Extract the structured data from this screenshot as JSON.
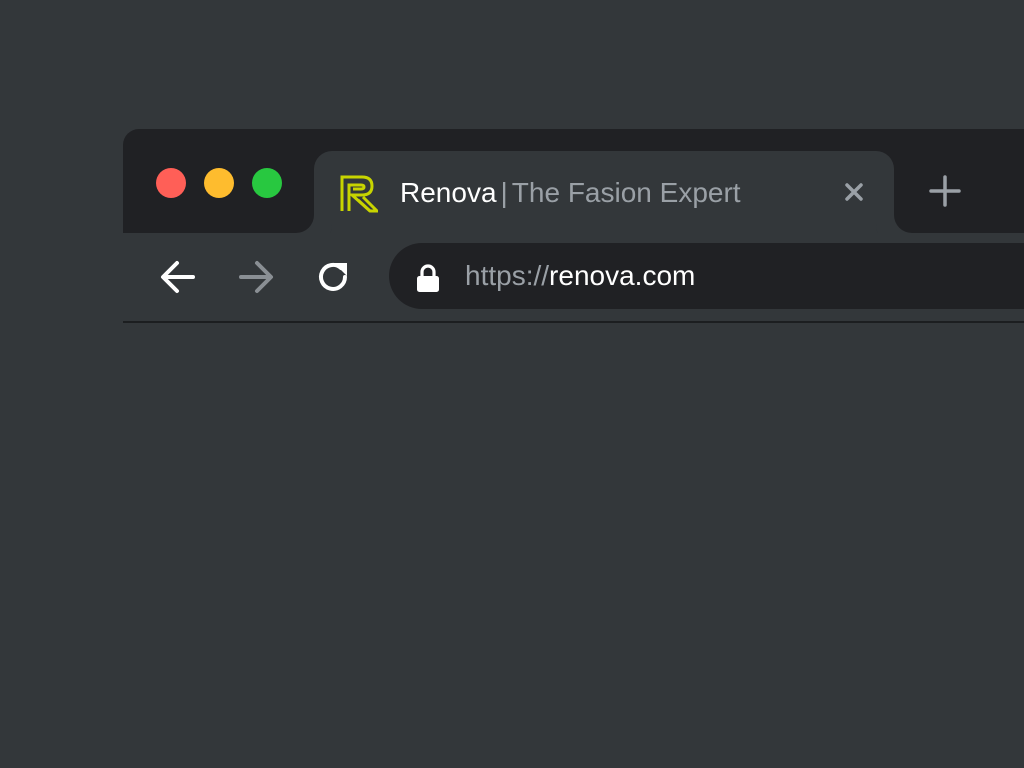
{
  "window": {
    "traffic_lights": {
      "close_color": "#ff5f57",
      "minimize_color": "#febc2e",
      "maximize_color": "#28c840"
    }
  },
  "tab": {
    "favicon": "renova-logo-icon",
    "favicon_color": "#c8d400",
    "title_site": "Renova",
    "title_separator": "|",
    "title_subtitle": "The Fasion Expert",
    "close_icon": "close-icon"
  },
  "new_tab_icon": "plus-icon",
  "toolbar": {
    "back_icon": "arrow-left-icon",
    "forward_icon": "arrow-right-icon",
    "reload_icon": "reload-icon"
  },
  "omnibox": {
    "lock_icon": "lock-icon",
    "url_scheme": "https://",
    "url_host": "renova.com"
  }
}
